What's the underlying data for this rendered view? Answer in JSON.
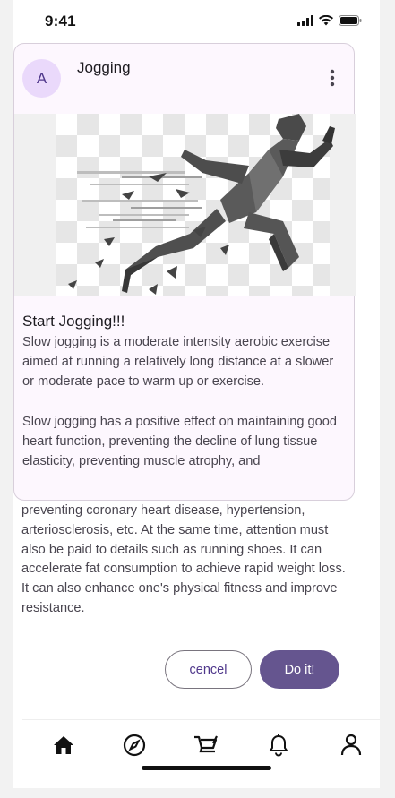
{
  "status_bar": {
    "time": "9:41"
  },
  "card": {
    "avatar_letter": "A",
    "title": "Jogging",
    "subtitle": "Start Jogging!!!",
    "paragraph_1": "Slow jogging is a moderate intensity aerobic exercise aimed at running a relatively long distance at a slower or moderate pace to warm up or exercise.",
    "paragraph_2_in_card": "Slow jogging has a positive effect on maintaining good heart function, preventing the decline of lung tissue elasticity, preventing muscle atrophy, and",
    "paragraph_2_overflow": "preventing coronary heart disease, hypertension, arteriosclerosis, etc. At the same time, attention must also be paid to details such as running shoes. It can accelerate fat consumption to achieve rapid weight loss. It can also enhance one's physical fitness and improve resistance."
  },
  "actions": {
    "cancel_label": "cencel",
    "confirm_label": "Do it!"
  },
  "nav": {
    "items": [
      {
        "icon": "home-icon"
      },
      {
        "icon": "compass-icon"
      },
      {
        "icon": "cart-icon"
      },
      {
        "icon": "bell-icon"
      },
      {
        "icon": "person-icon"
      }
    ]
  },
  "colors": {
    "primary": "#65558f",
    "card_bg": "#fdf7fe",
    "avatar_bg": "#ead9fb"
  }
}
